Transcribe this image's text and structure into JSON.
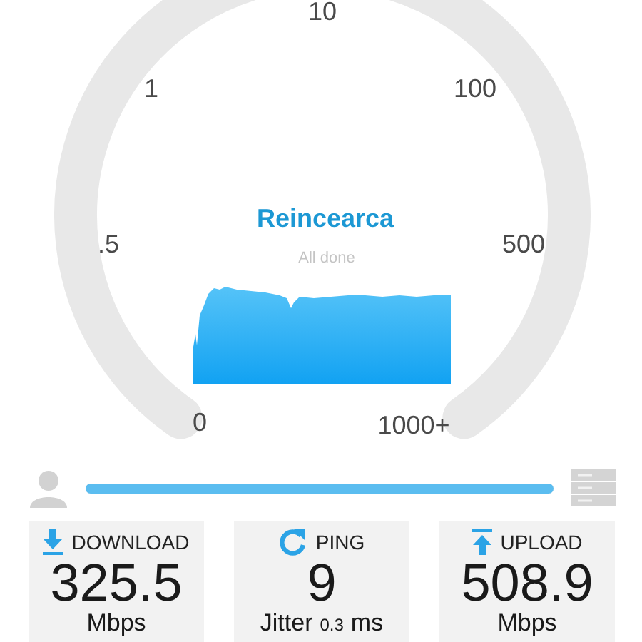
{
  "gauge": {
    "scale_labels": [
      "10",
      "1",
      "100",
      ".5",
      "500",
      "0",
      "1000+"
    ],
    "restart_button": "Reincearca",
    "status": "All done"
  },
  "progress": {
    "level": 1
  },
  "results": [
    {
      "kind": "download",
      "label": "DOWNLOAD",
      "value": "325.5",
      "unit": "Mbps"
    },
    {
      "kind": "ping",
      "label": "PING",
      "value": "9",
      "jitter_label": "Jitter",
      "jitter": "0.3",
      "jitter_unit": "ms"
    },
    {
      "kind": "upload",
      "label": "UPLOAD",
      "value": "508.9",
      "unit": "Mbps"
    }
  ]
}
